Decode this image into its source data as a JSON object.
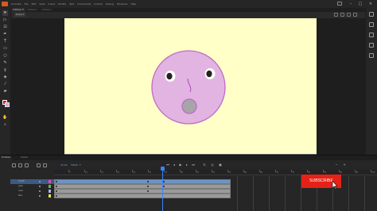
{
  "menubar": {
    "items": [
      "Animate",
      "File",
      "Edit",
      "View",
      "Insert",
      "Modify",
      "Text",
      "Commands",
      "Control",
      "Debug",
      "Windows",
      "Help"
    ],
    "logo_color": "#d85a1e"
  },
  "document_tabs": [
    "Untitled-1*",
    "Untitled-2",
    "Untitled-3"
  ],
  "editbar": {
    "scene_label": "Scene 1"
  },
  "tools": [
    "select-arrow-icon",
    "subselect-icon",
    "free-transform-icon",
    "pen-icon",
    "text-icon",
    "rectangle-icon",
    "oval-icon",
    "pencil-icon",
    "brush-icon",
    "paint-bucket-icon",
    "eyedropper-icon",
    "eraser-icon",
    "hand-icon",
    "zoom-icon"
  ],
  "stage": {
    "background": "#ffffc7"
  },
  "face": {
    "fill": "#e1b4e1",
    "stroke": "#c06ac8",
    "mouth_fill": "#a0a0a0"
  },
  "timeline": {
    "tabs": [
      "Timeline",
      "Output"
    ],
    "fps": "30.00",
    "fps_unit": "FPS",
    "current_frame": "40",
    "frame_unit": "F",
    "ruler_numbers": [
      "5",
      "10",
      "15",
      "20",
      "25",
      "30",
      "35",
      "40",
      "45",
      "50",
      "55",
      "60",
      "65",
      "70",
      "75",
      "80",
      "85",
      "90",
      "95",
      "100"
    ],
    "layers": [
      {
        "name": "mouth",
        "color": "#e84ab8",
        "selected": true
      },
      {
        "name": "eyes",
        "color": "#4cc84c",
        "selected": false
      },
      {
        "name": "nose",
        "color": "#b0b0ff",
        "selected": false
      },
      {
        "name": "face",
        "color": "#e8e84c",
        "selected": false
      }
    ],
    "playhead_color": "#3a82ff"
  },
  "overlay": {
    "subscribe_label": "SUBSCRIBE",
    "subscribe_color": "#e62117"
  }
}
